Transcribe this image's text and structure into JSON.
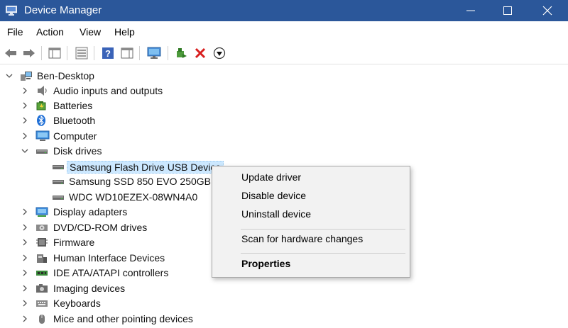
{
  "window": {
    "title": "Device Manager",
    "controls": [
      "minimize",
      "maximize",
      "close"
    ]
  },
  "menu": [
    "File",
    "Action",
    "View",
    "Help"
  ],
  "toolbar": [
    {
      "icon": "back-arrow-icon"
    },
    {
      "icon": "forward-arrow-icon"
    },
    {
      "icon": "properties-pane-icon"
    },
    {
      "icon": "show-hide-console-tree-icon"
    },
    {
      "icon": "help-icon"
    },
    {
      "icon": "action-pane-icon"
    },
    {
      "icon": "monitor-icon"
    },
    {
      "icon": "update-driver-icon"
    },
    {
      "icon": "uninstall-red-x-icon"
    },
    {
      "icon": "download-circle-icon"
    }
  ],
  "tree": {
    "root": "Ben-Desktop",
    "categories": [
      {
        "label": "Audio inputs and outputs",
        "icon": "speaker-icon",
        "expanded": false
      },
      {
        "label": "Batteries",
        "icon": "battery-icon",
        "expanded": false
      },
      {
        "label": "Bluetooth",
        "icon": "bluetooth-icon",
        "expanded": false
      },
      {
        "label": "Computer",
        "icon": "computer-icon",
        "expanded": false
      },
      {
        "label": "Disk drives",
        "icon": "disk-drive-icon",
        "expanded": true
      },
      {
        "label": "Display adapters",
        "icon": "display-adapter-icon",
        "expanded": false
      },
      {
        "label": "DVD/CD-ROM drives",
        "icon": "dvd-drive-icon",
        "expanded": false
      },
      {
        "label": "Firmware",
        "icon": "firmware-icon",
        "expanded": false
      },
      {
        "label": "Human Interface Devices",
        "icon": "hid-icon",
        "expanded": false
      },
      {
        "label": "IDE ATA/ATAPI controllers",
        "icon": "ide-controller-icon",
        "expanded": false
      },
      {
        "label": "Imaging devices",
        "icon": "camera-icon",
        "expanded": false
      },
      {
        "label": "Keyboards",
        "icon": "keyboard-icon",
        "expanded": false
      },
      {
        "label": "Mice and other pointing devices",
        "icon": "mouse-icon",
        "expanded": false
      }
    ],
    "disk_drives": [
      {
        "label": "Samsung Flash Drive USB Device",
        "selected": true
      },
      {
        "label": "Samsung SSD 850 EVO 250GB",
        "selected": false
      },
      {
        "label": "WDC WD10EZEX-08WN4A0",
        "selected": false
      }
    ]
  },
  "context_menu": {
    "items": [
      "Update driver",
      "Disable device",
      "Uninstall device",
      "Scan for hardware changes",
      "Properties"
    ]
  },
  "colors": {
    "titlebar": "#2b579a",
    "selection": "#cce8ff"
  }
}
